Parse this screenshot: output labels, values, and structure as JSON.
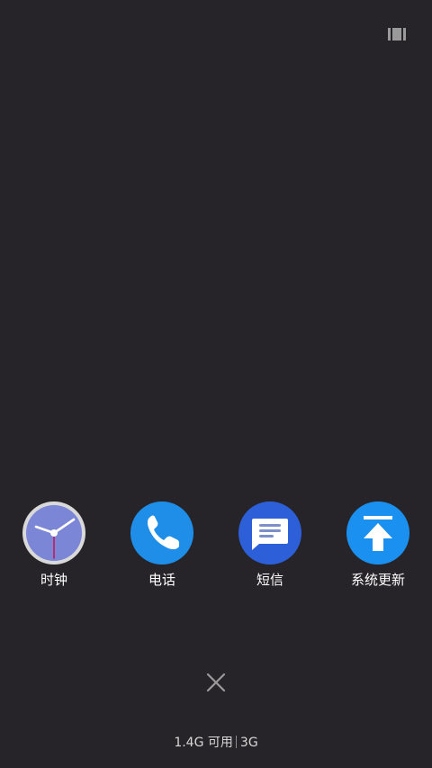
{
  "toolbar": {
    "view_toggle_icon": "grid-view-icon"
  },
  "apps": [
    {
      "label": "时钟",
      "icon": "clock-icon",
      "color": "#7b86d6"
    },
    {
      "label": "电话",
      "icon": "phone-icon",
      "color": "#1f8ee8"
    },
    {
      "label": "短信",
      "icon": "message-icon",
      "color": "#2d5fd8"
    },
    {
      "label": "系统更新",
      "icon": "system-update-icon",
      "color": "#1a90f0"
    }
  ],
  "close": {
    "icon": "close-icon"
  },
  "memory": {
    "available": "1.4G 可用",
    "total": "3G"
  },
  "colors": {
    "background": "#262428",
    "label": "#ffffff",
    "secondary_text": "#d8d8d8"
  }
}
